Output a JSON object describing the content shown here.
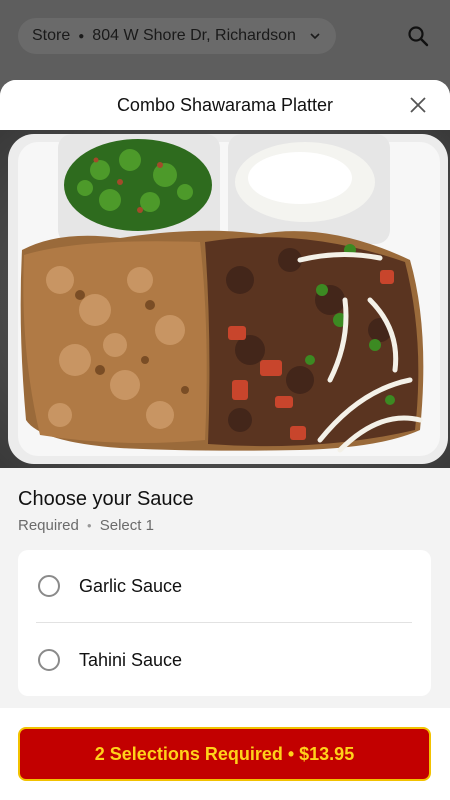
{
  "store_bar": {
    "label": "Store",
    "address": "804 W Shore Dr, Richardson"
  },
  "modal": {
    "title": "Combo Shawarama Platter"
  },
  "section": {
    "title": "Choose your Sauce",
    "required": "Required",
    "select": "Select 1",
    "options": [
      {
        "label": "Garlic Sauce"
      },
      {
        "label": "Tahini Sauce"
      }
    ]
  },
  "cta": {
    "label": "2 Selections Required • $13.95"
  },
  "colors": {
    "cta_bg": "#c20000",
    "cta_text": "#ffd21a",
    "cta_border": "#f2c200"
  },
  "icons": [
    "chevron-down-icon",
    "search-icon",
    "close-icon",
    "radio-unselected-icon"
  ]
}
